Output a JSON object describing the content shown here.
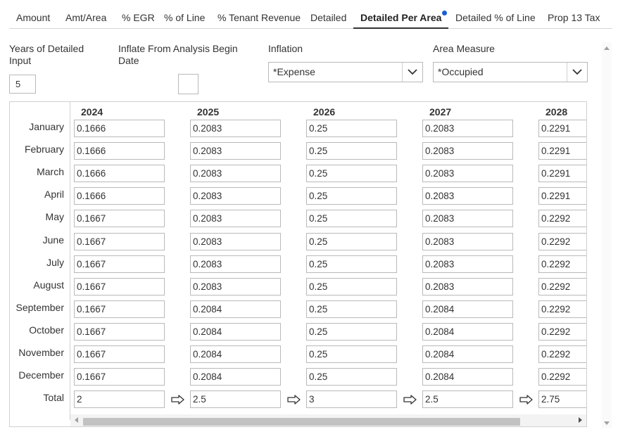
{
  "tabs": [
    {
      "label": "Amount"
    },
    {
      "label": "Amt/Area"
    },
    {
      "label": "% EGR"
    },
    {
      "label": "% of Line"
    },
    {
      "label": "% Tenant Revenue"
    },
    {
      "label": "Detailed"
    },
    {
      "label": "Detailed Per Area",
      "active": true
    },
    {
      "label": "Detailed % of Line"
    },
    {
      "label": "Prop 13 Tax"
    }
  ],
  "form": {
    "years_label_1": "Years of Detailed",
    "years_label_2": "Input",
    "years_value": "5",
    "inflate_label_1": "Inflate From Analysis Begin",
    "inflate_label_2": "Date",
    "inflation_label": "Inflation",
    "inflation_value": "*Expense",
    "area_label": "Area Measure",
    "area_value": "*Occupied"
  },
  "grid": {
    "years": [
      "2024",
      "2025",
      "2026",
      "2027",
      "2028"
    ],
    "months": [
      "January",
      "February",
      "March",
      "April",
      "May",
      "June",
      "July",
      "August",
      "September",
      "October",
      "November",
      "December"
    ],
    "total_label": "Total",
    "values": [
      [
        "0.1666",
        "0.1666",
        "0.1666",
        "0.1666",
        "0.1667",
        "0.1667",
        "0.1667",
        "0.1667",
        "0.1667",
        "0.1667",
        "0.1667",
        "0.1667"
      ],
      [
        "0.2083",
        "0.2083",
        "0.2083",
        "0.2083",
        "0.2083",
        "0.2083",
        "0.2083",
        "0.2083",
        "0.2084",
        "0.2084",
        "0.2084",
        "0.2084"
      ],
      [
        "0.25",
        "0.25",
        "0.25",
        "0.25",
        "0.25",
        "0.25",
        "0.25",
        "0.25",
        "0.25",
        "0.25",
        "0.25",
        "0.25"
      ],
      [
        "0.2083",
        "0.2083",
        "0.2083",
        "0.2083",
        "0.2083",
        "0.2083",
        "0.2083",
        "0.2083",
        "0.2084",
        "0.2084",
        "0.2084",
        "0.2084"
      ],
      [
        "0.2291",
        "0.2291",
        "0.2291",
        "0.2291",
        "0.2292",
        "0.2292",
        "0.2292",
        "0.2292",
        "0.2292",
        "0.2292",
        "0.2292",
        "0.2292"
      ]
    ],
    "totals": [
      "2",
      "2.5",
      "3",
      "2.5",
      "2.75"
    ]
  },
  "icons": {
    "dropdown": "chevron-down-icon",
    "carry_forward": "arrow-right-icon",
    "tab_indicator": "dot-indicator-icon"
  },
  "colors": {
    "accent_dot": "#1a5fd1",
    "border": "#b9b9b9"
  }
}
